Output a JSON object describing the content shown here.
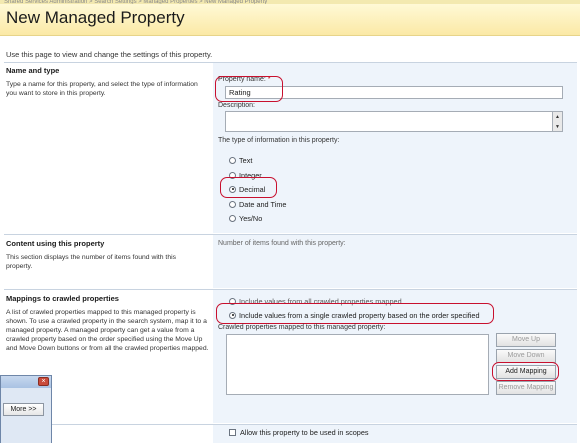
{
  "page": {
    "title": "New Managed Property",
    "intro": "Use this page to view and change the settings of this property."
  },
  "breadcrumb": {
    "text": "Shared Services Administration > Search Settings > Managed Properties > New Managed Property"
  },
  "name_type": {
    "heading": "Name and type",
    "description": "Type a name for this property, and select the type of information you want to store in this property.",
    "property_name_label": "Property name:",
    "required_marker": "*",
    "property_name_value": "Rating",
    "description_label": "Description:",
    "type_label": "The type of information in this property:",
    "types": [
      {
        "label": "Text",
        "checked": false
      },
      {
        "label": "Integer",
        "checked": false
      },
      {
        "label": "Decimal",
        "checked": true
      },
      {
        "label": "Date and Time",
        "checked": false
      },
      {
        "label": "Yes/No",
        "checked": false
      }
    ]
  },
  "content": {
    "heading": "Content using this property",
    "description": "This section displays the number of items found with this property.",
    "count_label": "Number of items found with this property:"
  },
  "mappings": {
    "heading": "Mappings to crawled properties",
    "description": "A list of crawled properties mapped to this managed property is shown. To use a crawled property in the search system, map it to a managed property. A managed property can get a value from a crawled property based on the order specified using the Move Up and Move Down buttons or from all the crawled properties mapped.",
    "option_all": "Include values from all crawled properties mapped",
    "option_single": "Include values from a single crawled property based on the order specified",
    "selected_option": "single",
    "list_label": "Crawled properties mapped to this managed property:",
    "buttons": {
      "move_up": "Move Up",
      "move_down": "Move Down",
      "add_mapping": "Add Mapping",
      "remove_mapping": "Remove Mapping"
    }
  },
  "scopes": {
    "checkbox_label": "Allow this property to be used in scopes",
    "checked": false
  },
  "dialog": {
    "more_button": "More >>",
    "close_glyph": "×"
  },
  "colors": {
    "highlight_ring": "#c8102e",
    "title_band": "#fbe9a6",
    "panel": "#eef4fb"
  }
}
